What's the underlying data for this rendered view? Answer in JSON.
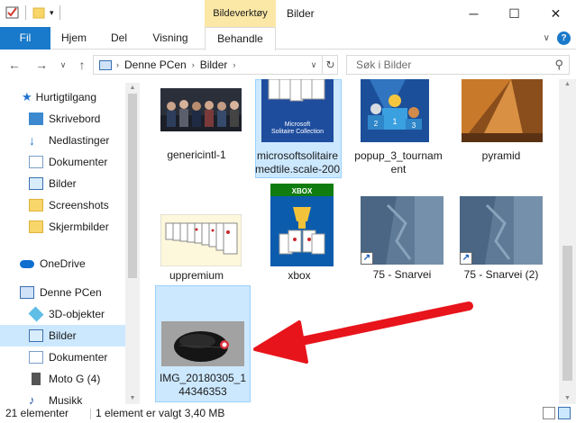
{
  "window": {
    "title": "Bilder",
    "context_tab": "Bildeverktøy",
    "minimize_icon": "─",
    "maximize_icon": "☐",
    "close_icon": "✕"
  },
  "ribbon": {
    "tabs": [
      "Fil",
      "Hjem",
      "Del",
      "Visning",
      "Behandle"
    ],
    "expand_icon": "∨",
    "help_icon": "?"
  },
  "address": {
    "crumbs": [
      "Denne PCen",
      "Bilder"
    ],
    "search_placeholder": "Søk i Bilder"
  },
  "nav": {
    "items": [
      {
        "label": "Hurtigtilgang"
      },
      {
        "label": "Skrivebord"
      },
      {
        "label": "Nedlastinger"
      },
      {
        "label": "Dokumenter"
      },
      {
        "label": "Bilder"
      },
      {
        "label": "Screenshots"
      },
      {
        "label": "Skjermbilder"
      },
      {
        "label": "OneDrive"
      },
      {
        "label": "Denne PCen"
      },
      {
        "label": "3D-objekter"
      },
      {
        "label": "Bilder"
      },
      {
        "label": "Dokumenter"
      },
      {
        "label": "Moto G (4)"
      },
      {
        "label": "Musikk"
      }
    ]
  },
  "files": [
    {
      "name": "genericintl-1"
    },
    {
      "name": "microsoftsolitairemedtile.scale-200",
      "thumb_text": "Microsoft Solitaire Collection"
    },
    {
      "name": "popup_3_tournament"
    },
    {
      "name": "pyramid"
    },
    {
      "name": "uppremium"
    },
    {
      "name": "xbox",
      "thumb_text": "XBOX"
    },
    {
      "name": "75 - Snarvei"
    },
    {
      "name": "75 - Snarvei (2)"
    },
    {
      "name": "IMG_20180305_144346353"
    }
  ],
  "status": {
    "count": "21 elementer",
    "selection": "1 element er valgt  3,40 MB"
  },
  "colors": {
    "accent": "#1979ca",
    "selection": "#cce8ff",
    "context_tab": "#fbe8a6",
    "annotation_arrow": "#e8141b"
  }
}
